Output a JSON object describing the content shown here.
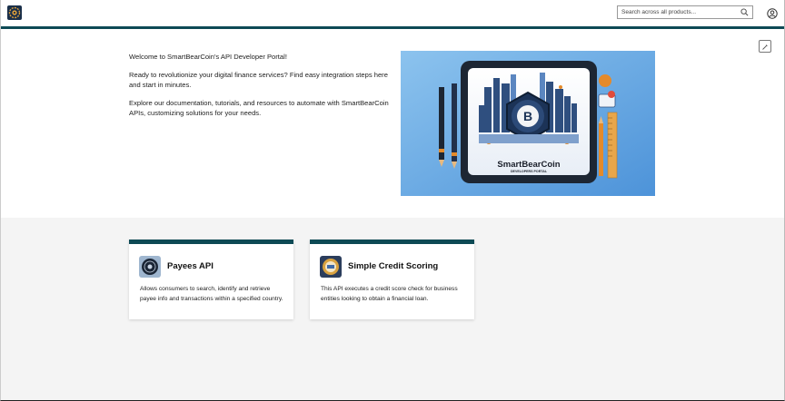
{
  "header": {
    "logo": "smartbearcoin-logo-icon",
    "search_placeholder": "Search across all products...",
    "search_icon": "search-icon",
    "user_icon": "user-account-icon"
  },
  "hero": {
    "paragraphs": [
      "Welcome to SmartBearCoin's API Developer Portal!",
      "Ready to revolutionize your digital finance services? Find easy integration steps here and start in minutes.",
      "Explore our documentation, tutorials, and resources to automate with SmartBearCoin APIs, customizing solutions for your needs."
    ],
    "image_brand": "SmartBearCoin",
    "image_subtitle": "DEVELOPERS PORTAL",
    "edit_icon": "edit-pencil-icon"
  },
  "cards": [
    {
      "title": "Payees API",
      "description": "Allows consumers to search, identify and retrieve payee info and transactions within a specified country."
    },
    {
      "title": "Simple Credit Scoring",
      "description": "This API executes a credit score check for business entities looking to obtain a financial loan."
    }
  ],
  "colors": {
    "accent": "#0d4a55",
    "page_background": "#f4f4f4"
  }
}
